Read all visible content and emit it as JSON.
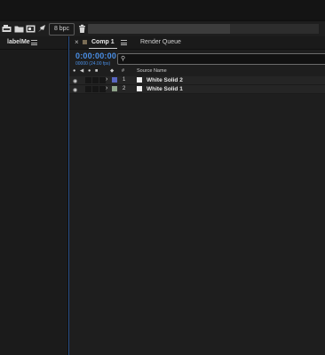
{
  "toolbar": {
    "icons": [
      "interpret-footage-icon",
      "new-folder-icon",
      "new-composition-icon",
      "render-queue-icon"
    ],
    "bit_depth": "8 bpc",
    "trash_icon": "trash-icon"
  },
  "left_panel": {
    "tab_label": "labelMe",
    "menu_icon": "panel-menu-icon"
  },
  "timeline": {
    "tabs": [
      {
        "label": "Comp 1",
        "active": true
      },
      {
        "label": "Render Queue",
        "active": false
      }
    ],
    "timecode": "0:00:00:00",
    "frames": "00000 (24.00 fps)",
    "search_placeholder": "",
    "columns": {
      "number": "#",
      "source_name": "Source Name"
    },
    "layers": [
      {
        "number": "1",
        "name": "White Solid 2",
        "label_color": "#5866c0"
      },
      {
        "number": "2",
        "name": "White Solid 1",
        "label_color": "#8fa48a"
      }
    ]
  },
  "colors": {
    "accent_blue": "#4a8fe6",
    "panel_border": "#2a4f86"
  }
}
